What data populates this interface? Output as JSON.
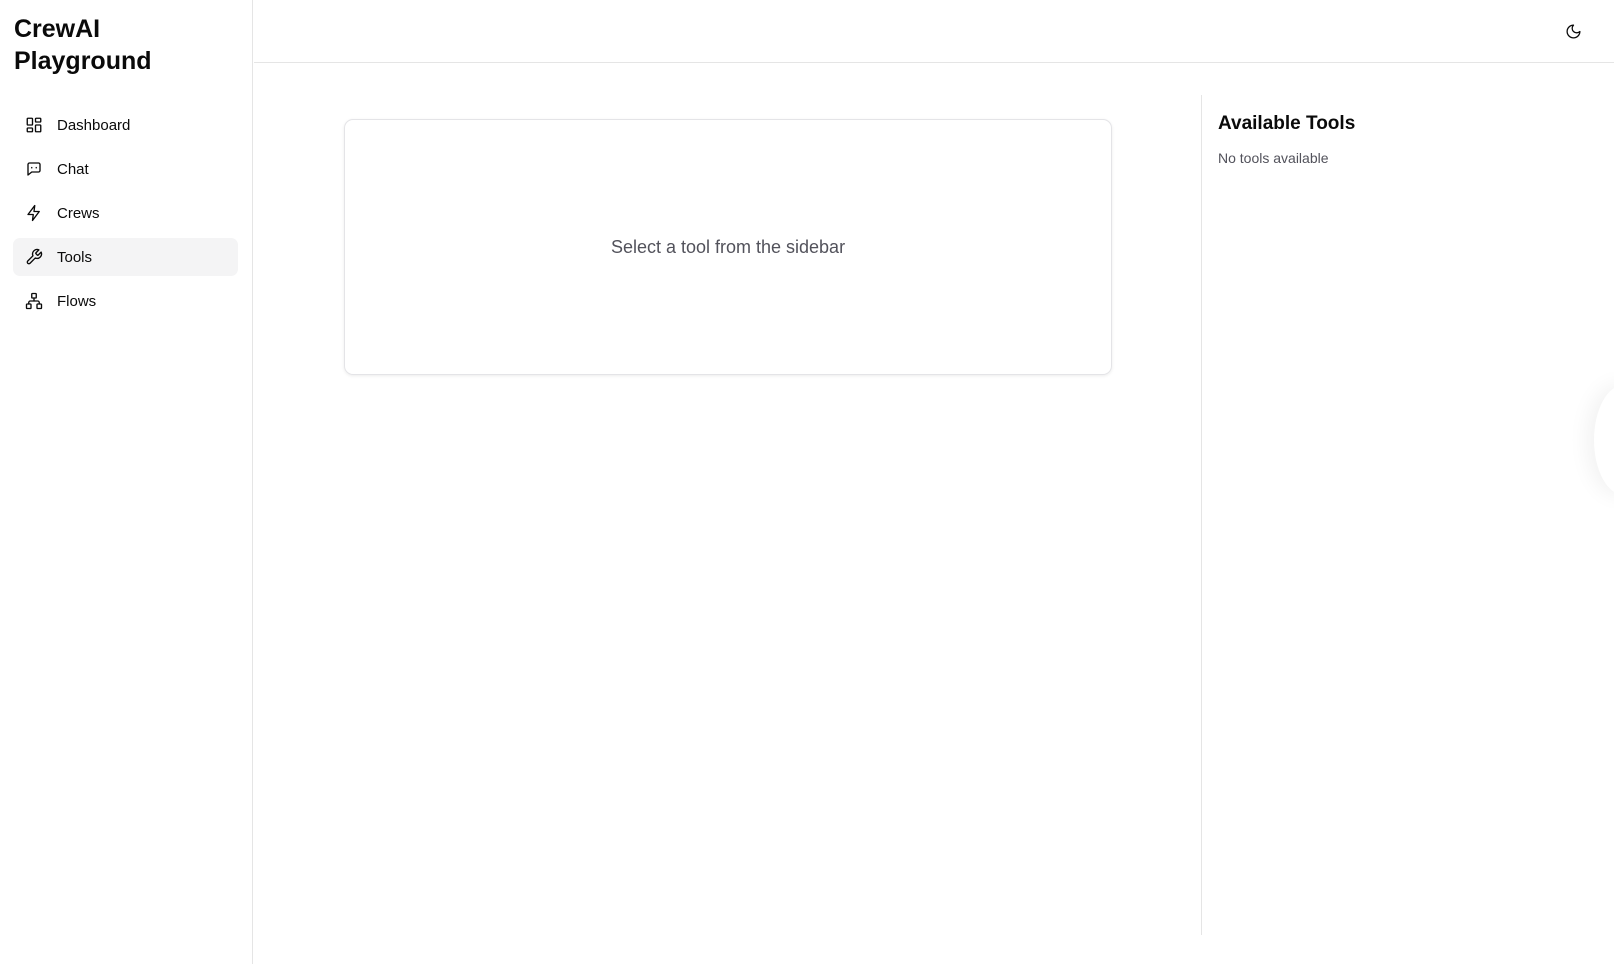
{
  "app": {
    "title": "CrewAI Playground"
  },
  "sidebar": {
    "items": [
      {
        "label": "Dashboard",
        "icon": "dashboard-icon"
      },
      {
        "label": "Chat",
        "icon": "chat-icon"
      },
      {
        "label": "Crews",
        "icon": "lightning-icon"
      },
      {
        "label": "Tools",
        "icon": "wrench-icon",
        "active": true
      },
      {
        "label": "Flows",
        "icon": "flow-icon"
      }
    ]
  },
  "header": {
    "theme_toggle_icon": "moon-icon"
  },
  "main": {
    "placeholder": "Select a tool from the sidebar"
  },
  "tools_panel": {
    "title": "Available Tools",
    "empty_text": "No tools available"
  },
  "colors": {
    "active_bg": "#f4f4f5",
    "border": "#e5e5e5",
    "muted_text": "#52525b"
  }
}
